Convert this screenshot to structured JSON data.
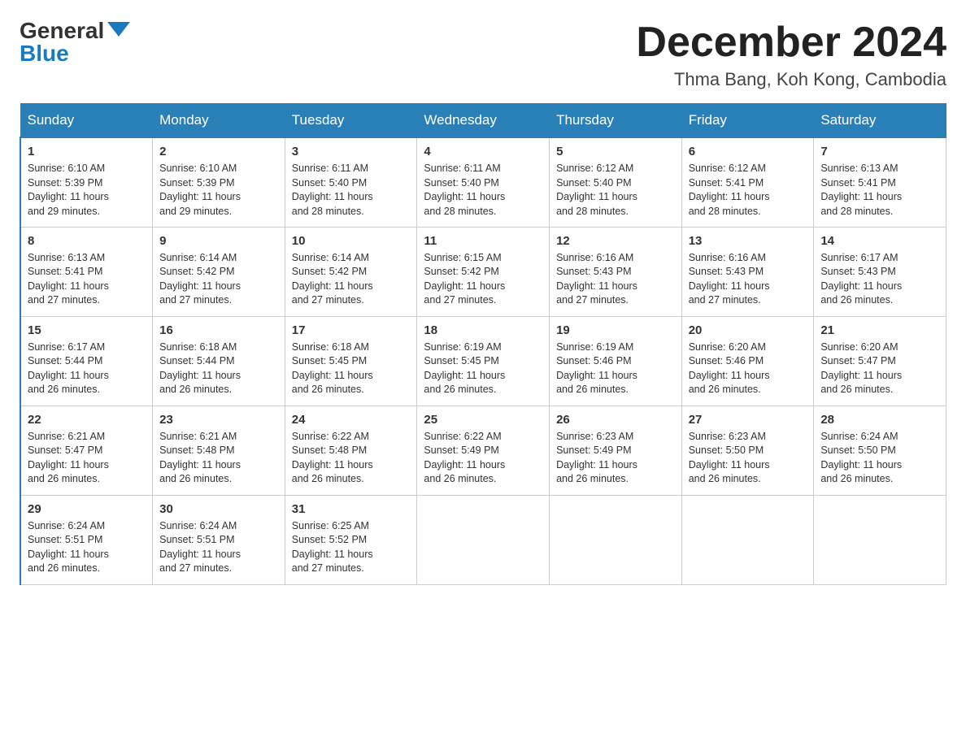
{
  "header": {
    "logo_general": "General",
    "logo_blue": "Blue",
    "title": "December 2024",
    "location": "Thma Bang, Koh Kong, Cambodia"
  },
  "days_of_week": [
    "Sunday",
    "Monday",
    "Tuesday",
    "Wednesday",
    "Thursday",
    "Friday",
    "Saturday"
  ],
  "weeks": [
    [
      {
        "day": "1",
        "sunrise": "6:10 AM",
        "sunset": "5:39 PM",
        "daylight": "11 hours and 29 minutes."
      },
      {
        "day": "2",
        "sunrise": "6:10 AM",
        "sunset": "5:39 PM",
        "daylight": "11 hours and 29 minutes."
      },
      {
        "day": "3",
        "sunrise": "6:11 AM",
        "sunset": "5:40 PM",
        "daylight": "11 hours and 28 minutes."
      },
      {
        "day": "4",
        "sunrise": "6:11 AM",
        "sunset": "5:40 PM",
        "daylight": "11 hours and 28 minutes."
      },
      {
        "day": "5",
        "sunrise": "6:12 AM",
        "sunset": "5:40 PM",
        "daylight": "11 hours and 28 minutes."
      },
      {
        "day": "6",
        "sunrise": "6:12 AM",
        "sunset": "5:41 PM",
        "daylight": "11 hours and 28 minutes."
      },
      {
        "day": "7",
        "sunrise": "6:13 AM",
        "sunset": "5:41 PM",
        "daylight": "11 hours and 28 minutes."
      }
    ],
    [
      {
        "day": "8",
        "sunrise": "6:13 AM",
        "sunset": "5:41 PM",
        "daylight": "11 hours and 27 minutes."
      },
      {
        "day": "9",
        "sunrise": "6:14 AM",
        "sunset": "5:42 PM",
        "daylight": "11 hours and 27 minutes."
      },
      {
        "day": "10",
        "sunrise": "6:14 AM",
        "sunset": "5:42 PM",
        "daylight": "11 hours and 27 minutes."
      },
      {
        "day": "11",
        "sunrise": "6:15 AM",
        "sunset": "5:42 PM",
        "daylight": "11 hours and 27 minutes."
      },
      {
        "day": "12",
        "sunrise": "6:16 AM",
        "sunset": "5:43 PM",
        "daylight": "11 hours and 27 minutes."
      },
      {
        "day": "13",
        "sunrise": "6:16 AM",
        "sunset": "5:43 PM",
        "daylight": "11 hours and 27 minutes."
      },
      {
        "day": "14",
        "sunrise": "6:17 AM",
        "sunset": "5:43 PM",
        "daylight": "11 hours and 26 minutes."
      }
    ],
    [
      {
        "day": "15",
        "sunrise": "6:17 AM",
        "sunset": "5:44 PM",
        "daylight": "11 hours and 26 minutes."
      },
      {
        "day": "16",
        "sunrise": "6:18 AM",
        "sunset": "5:44 PM",
        "daylight": "11 hours and 26 minutes."
      },
      {
        "day": "17",
        "sunrise": "6:18 AM",
        "sunset": "5:45 PM",
        "daylight": "11 hours and 26 minutes."
      },
      {
        "day": "18",
        "sunrise": "6:19 AM",
        "sunset": "5:45 PM",
        "daylight": "11 hours and 26 minutes."
      },
      {
        "day": "19",
        "sunrise": "6:19 AM",
        "sunset": "5:46 PM",
        "daylight": "11 hours and 26 minutes."
      },
      {
        "day": "20",
        "sunrise": "6:20 AM",
        "sunset": "5:46 PM",
        "daylight": "11 hours and 26 minutes."
      },
      {
        "day": "21",
        "sunrise": "6:20 AM",
        "sunset": "5:47 PM",
        "daylight": "11 hours and 26 minutes."
      }
    ],
    [
      {
        "day": "22",
        "sunrise": "6:21 AM",
        "sunset": "5:47 PM",
        "daylight": "11 hours and 26 minutes."
      },
      {
        "day": "23",
        "sunrise": "6:21 AM",
        "sunset": "5:48 PM",
        "daylight": "11 hours and 26 minutes."
      },
      {
        "day": "24",
        "sunrise": "6:22 AM",
        "sunset": "5:48 PM",
        "daylight": "11 hours and 26 minutes."
      },
      {
        "day": "25",
        "sunrise": "6:22 AM",
        "sunset": "5:49 PM",
        "daylight": "11 hours and 26 minutes."
      },
      {
        "day": "26",
        "sunrise": "6:23 AM",
        "sunset": "5:49 PM",
        "daylight": "11 hours and 26 minutes."
      },
      {
        "day": "27",
        "sunrise": "6:23 AM",
        "sunset": "5:50 PM",
        "daylight": "11 hours and 26 minutes."
      },
      {
        "day": "28",
        "sunrise": "6:24 AM",
        "sunset": "5:50 PM",
        "daylight": "11 hours and 26 minutes."
      }
    ],
    [
      {
        "day": "29",
        "sunrise": "6:24 AM",
        "sunset": "5:51 PM",
        "daylight": "11 hours and 26 minutes."
      },
      {
        "day": "30",
        "sunrise": "6:24 AM",
        "sunset": "5:51 PM",
        "daylight": "11 hours and 27 minutes."
      },
      {
        "day": "31",
        "sunrise": "6:25 AM",
        "sunset": "5:52 PM",
        "daylight": "11 hours and 27 minutes."
      },
      null,
      null,
      null,
      null
    ]
  ],
  "labels": {
    "sunrise": "Sunrise:",
    "sunset": "Sunset:",
    "daylight": "Daylight:"
  }
}
